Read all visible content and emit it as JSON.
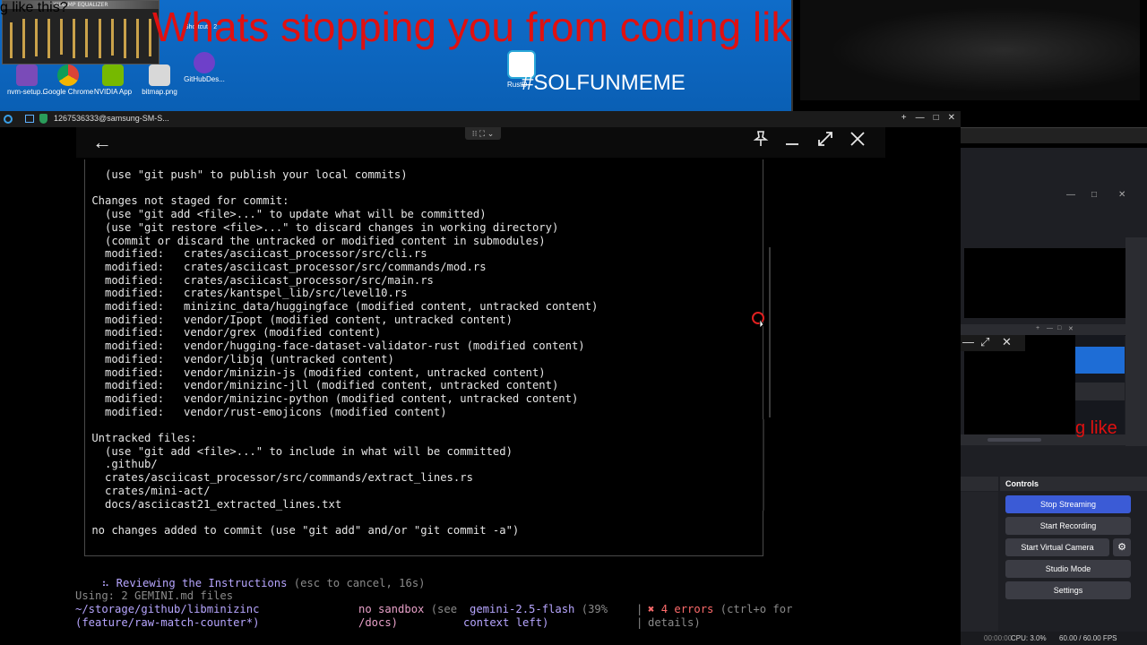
{
  "desktop": {
    "meme_headline": "Whats stopping you from coding like this?",
    "meme_hashtag": "#SOLFUNMEME",
    "winamp_title": "WINAMP EQUALIZER",
    "icons": [
      {
        "label": "nvm-setup...",
        "color": "#7a4bb8"
      },
      {
        "label": "Google Chrome",
        "color": "#e5a52a"
      },
      {
        "label": "NVIDIA App",
        "color": "#76b900"
      },
      {
        "label": "bitmap.png",
        "color": "#d8d8d8"
      },
      {
        "label": "GitHubDes...",
        "color": "#6e40c9"
      }
    ],
    "shortcut_label": "Shortcut - 2",
    "rust_label": "RustD"
  },
  "remote_window": {
    "title": "1267536333@samsung-SM-S...",
    "controls": [
      "+",
      "—",
      "□",
      "✕"
    ],
    "header_center": "⁝⁝ ⛶ ⌄"
  },
  "terminal": {
    "lines": [
      "   (use \"git push\" to publish your local commits)",
      "",
      " Changes not staged for commit:",
      "   (use \"git add <file>...\" to update what will be committed)",
      "   (use \"git restore <file>...\" to discard changes in working directory)",
      "   (commit or discard the untracked or modified content in submodules)",
      "   modified:   crates/asciicast_processor/src/cli.rs",
      "   modified:   crates/asciicast_processor/src/commands/mod.rs",
      "   modified:   crates/asciicast_processor/src/main.rs",
      "   modified:   crates/kantspel_lib/src/level10.rs",
      "   modified:   minizinc_data/huggingface (modified content, untracked content)",
      "   modified:   vendor/Ipopt (modified content, untracked content)",
      "   modified:   vendor/grex (modified content)",
      "   modified:   vendor/hugging-face-dataset-validator-rust (modified content)",
      "   modified:   vendor/libjq (untracked content)",
      "   modified:   vendor/minizin-js (modified content, untracked content)",
      "   modified:   vendor/minizinc-jll (modified content, untracked content)",
      "   modified:   vendor/minizinc-python (modified content, untracked content)",
      "   modified:   vendor/rust-emojicons (modified content)",
      "",
      " Untracked files:",
      "   (use \"git add <file>...\" to include in what will be committed)",
      "   .github/",
      "   crates/asciicast_processor/src/commands/extract_lines.rs",
      "   crates/mini-act/",
      "   docs/asciicast21_extracted_lines.txt",
      "",
      " no changes added to commit (use \"git add\" and/or \"git commit -a\")"
    ],
    "spinner": "⠦",
    "reviewing_text": "Reviewing the Instructions",
    "reviewing_hint": " (esc to cancel, 16s)",
    "using_files": "Using: 2 GEMINI.md files",
    "path_line1": "~/storage/github/libminizinc",
    "path_line2": "(feature/raw-match-counter*)",
    "sandbox_main": "no sandbox",
    "sandbox_see": " (see",
    "sandbox_docs": "/docs)",
    "model_main": "gemini-2.5-flash",
    "model_pct": " (39%",
    "model_context": "context left)",
    "errors_icon": "✖",
    "errors_main": "4 errors",
    "errors_hint": " (ctrl+o for",
    "errors_details": "details)"
  },
  "obs": {
    "preview_text": "g like this?",
    "preview_small": "g like",
    "controls_title": "Controls",
    "buttons": {
      "stop_streaming": "Stop Streaming",
      "start_recording": "Start Recording",
      "start_virtual_camera": "Start Virtual Camera",
      "studio_mode": "Studio Mode",
      "settings": "Settings"
    },
    "status": {
      "time": "00:00:00",
      "cpu": "CPU: 3.0%",
      "fps": "60.00 / 60.00 FPS"
    }
  },
  "colors": {
    "meme_red": "#e01010",
    "obs_primary": "#3b5bd6",
    "terminal_text": "#e6e6e6",
    "status_pink": "#e8a0c8",
    "status_purple": "#b7a6ff",
    "error_red": "#ff6b6b"
  }
}
